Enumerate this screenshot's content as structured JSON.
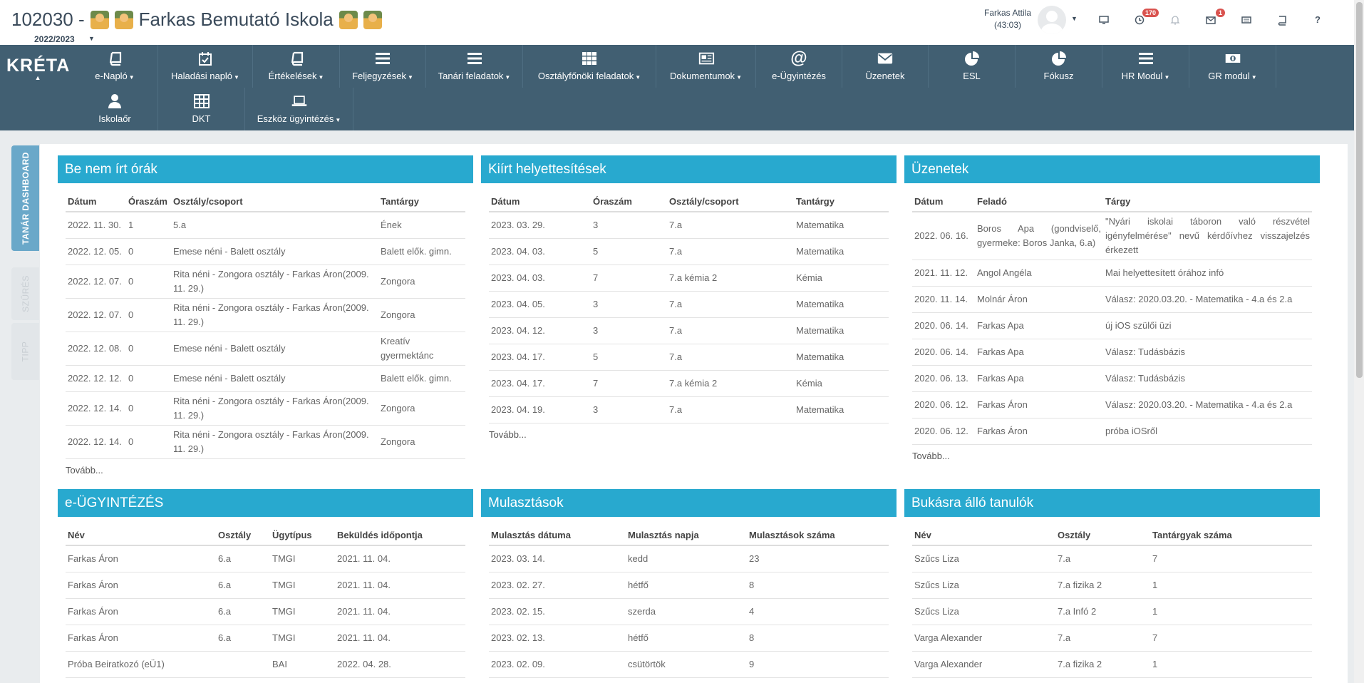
{
  "header": {
    "school_code": "102030 -",
    "school_name": "Farkas Bemutató Iskola",
    "year": "2022/2023",
    "user_name": "Farkas Attila",
    "session": "(43:03)",
    "badge_clock": "170",
    "badge_mail": "1",
    "help": "?"
  },
  "logo": {
    "text": "KRÉTA"
  },
  "nav": {
    "row1": [
      {
        "label": "e-Napló",
        "dropdown": true,
        "icon": "book-icon"
      },
      {
        "label": "Haladási napló",
        "dropdown": true,
        "icon": "calendar-check-icon"
      },
      {
        "label": "Értékelések",
        "dropdown": true,
        "icon": "book-icon"
      },
      {
        "label": "Feljegyzések",
        "dropdown": true,
        "icon": "list-icon"
      },
      {
        "label": "Tanári feladatok",
        "dropdown": true,
        "icon": "list-icon"
      },
      {
        "label": "Osztályfőnöki feladatok",
        "dropdown": true,
        "icon": "grid-icon"
      },
      {
        "label": "Dokumentumok",
        "dropdown": true,
        "icon": "newspaper-icon"
      },
      {
        "label": "e-Ügyintézés",
        "dropdown": false,
        "icon": "at-icon"
      },
      {
        "label": "Üzenetek",
        "dropdown": false,
        "icon": "envelope-icon"
      },
      {
        "label": "ESL",
        "dropdown": false,
        "icon": "pie-chart-icon"
      },
      {
        "label": "Fókusz",
        "dropdown": false,
        "icon": "pie-chart-icon"
      },
      {
        "label": "HR Modul",
        "dropdown": true,
        "icon": "list-icon"
      },
      {
        "label": "GR modul",
        "dropdown": true,
        "icon": "money-icon"
      }
    ],
    "row2": [
      {
        "label": "Iskolaőr",
        "dropdown": false,
        "icon": "user-icon"
      },
      {
        "label": "DKT",
        "dropdown": false,
        "icon": "table-icon"
      },
      {
        "label": "Eszköz ügyintézés",
        "dropdown": true,
        "icon": "laptop-icon"
      }
    ]
  },
  "sidetabs": {
    "dashboard": "TANÁR DASHBOARD",
    "filter": "SZŰRÉS",
    "tip": "TIPP"
  },
  "more_label": "Tovább...",
  "panels": {
    "be_nem_irt": {
      "title": "Be nem írt órák",
      "headers": [
        "Dátum",
        "Óraszám",
        "Osztály/csoport",
        "Tantárgy"
      ],
      "rows": [
        [
          "2022. 11. 30.",
          "1",
          "5.a",
          "Ének"
        ],
        [
          "2022. 12. 05.",
          "0",
          "Emese néni - Balett osztály",
          "Balett elők. gimn."
        ],
        [
          "2022. 12. 07.",
          "0",
          "Rita néni - Zongora osztály - Farkas Áron(2009. 11. 29.)",
          "Zongora"
        ],
        [
          "2022. 12. 07.",
          "0",
          "Rita néni - Zongora osztály - Farkas Áron(2009. 11. 29.)",
          "Zongora"
        ],
        [
          "2022. 12. 08.",
          "0",
          "Emese néni - Balett osztály",
          "Kreatív gyermektánc"
        ],
        [
          "2022. 12. 12.",
          "0",
          "Emese néni - Balett osztály",
          "Balett elők. gimn."
        ],
        [
          "2022. 12. 14.",
          "0",
          "Rita néni - Zongora osztály - Farkas Áron(2009. 11. 29.)",
          "Zongora"
        ],
        [
          "2022. 12. 14.",
          "0",
          "Rita néni - Zongora osztály - Farkas Áron(2009. 11. 29.)",
          "Zongora"
        ]
      ]
    },
    "helyettesitesek": {
      "title": "Kiírt helyettesítések",
      "headers": [
        "Dátum",
        "Óraszám",
        "Osztály/csoport",
        "Tantárgy"
      ],
      "rows": [
        [
          "2023. 03. 29.",
          "3",
          "7.a",
          "Matematika"
        ],
        [
          "2023. 04. 03.",
          "5",
          "7.a",
          "Matematika"
        ],
        [
          "2023. 04. 03.",
          "7",
          "7.a kémia 2",
          "Kémia"
        ],
        [
          "2023. 04. 05.",
          "3",
          "7.a",
          "Matematika"
        ],
        [
          "2023. 04. 12.",
          "3",
          "7.a",
          "Matematika"
        ],
        [
          "2023. 04. 17.",
          "5",
          "7.a",
          "Matematika"
        ],
        [
          "2023. 04. 17.",
          "7",
          "7.a kémia 2",
          "Kémia"
        ],
        [
          "2023. 04. 19.",
          "3",
          "7.a",
          "Matematika"
        ]
      ]
    },
    "uzenetek": {
      "title": "Üzenetek",
      "headers": [
        "Dátum",
        "Feladó",
        "Tárgy"
      ],
      "rows": [
        [
          "2022. 06. 16.",
          "Boros Apa (gondviselő, gyermeke: Boros Janka, 6.a)",
          "\"Nyári iskolai táboron való részvétel igényfelmérése\" nevű kérdőívhez visszajelzés érkezett"
        ],
        [
          "2021. 11. 12.",
          "Angol Angéla",
          "Mai helyettesített órához infó"
        ],
        [
          "2020. 11. 14.",
          "Molnár Áron",
          "Válasz: 2020.03.20. - Matematika - 4.a és 2.a"
        ],
        [
          "2020. 06. 14.",
          "Farkas Apa",
          "új iOS szülői üzi"
        ],
        [
          "2020. 06. 14.",
          "Farkas Apa",
          "Válasz: Tudásbázis"
        ],
        [
          "2020. 06. 13.",
          "Farkas Apa",
          "Válasz: Tudásbázis"
        ],
        [
          "2020. 06. 12.",
          "Farkas Áron",
          "Válasz: 2020.03.20. - Matematika - 4.a és 2.a"
        ],
        [
          "2020. 06. 12.",
          "Farkas Áron",
          "próba iOSről"
        ]
      ]
    },
    "eugyintezes": {
      "title": "e-ÜGYINTÉZÉS",
      "headers": [
        "Név",
        "Osztály",
        "Ügytípus",
        "Beküldés időpontja"
      ],
      "rows": [
        [
          "Farkas Áron",
          "6.a",
          "TMGI",
          "2021. 11. 04."
        ],
        [
          "Farkas Áron",
          "6.a",
          "TMGI",
          "2021. 11. 04."
        ],
        [
          "Farkas Áron",
          "6.a",
          "TMGI",
          "2021. 11. 04."
        ],
        [
          "Farkas Áron",
          "6.a",
          "TMGI",
          "2021. 11. 04."
        ],
        [
          "Próba Beiratkozó (eÜ1)",
          "",
          "BAI",
          "2022. 04. 28."
        ]
      ]
    },
    "mulasztasok": {
      "title": "Mulasztások",
      "headers": [
        "Mulasztás dátuma",
        "Mulasztás napja",
        "Mulasztások száma"
      ],
      "rows": [
        [
          "2023. 03. 14.",
          "kedd",
          "23"
        ],
        [
          "2023. 02. 27.",
          "hétfő",
          "8"
        ],
        [
          "2023. 02. 15.",
          "szerda",
          "4"
        ],
        [
          "2023. 02. 13.",
          "hétfő",
          "8"
        ],
        [
          "2023. 02. 09.",
          "csütörtök",
          "9"
        ]
      ]
    },
    "bukasra": {
      "title": "Bukásra álló tanulók",
      "headers": [
        "Név",
        "Osztály",
        "Tantárgyak száma"
      ],
      "rows": [
        [
          "Szűcs Liza",
          "7.a",
          "7"
        ],
        [
          "Szűcs Liza",
          "7.a fizika 2",
          "1"
        ],
        [
          "Szűcs Liza",
          "7.a Infó 2",
          "1"
        ],
        [
          "Varga Alexander",
          "7.a",
          "7"
        ],
        [
          "Varga Alexander",
          "7.a fizika 2",
          "1"
        ]
      ]
    }
  }
}
